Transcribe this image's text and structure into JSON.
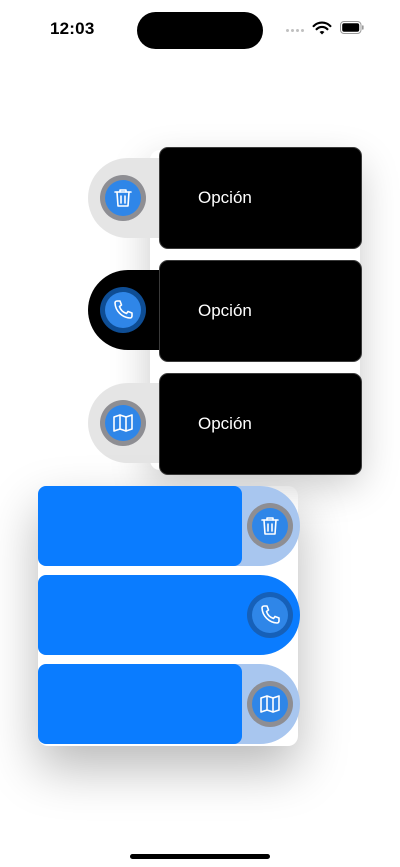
{
  "status_bar": {
    "time": "12:03"
  },
  "top_menu": {
    "items": [
      {
        "label": "Opción",
        "icon": "trash-icon"
      },
      {
        "label": "Opción",
        "icon": "phone-icon"
      },
      {
        "label": "Opción",
        "icon": "map-icon"
      }
    ]
  },
  "bottom_menu": {
    "items": [
      {
        "icon": "trash-icon"
      },
      {
        "icon": "phone-icon"
      },
      {
        "icon": "map-icon"
      }
    ]
  },
  "colors": {
    "accent_blue": "#0a7cff",
    "icon_blue": "#2f86e8",
    "card_black": "#000000"
  }
}
